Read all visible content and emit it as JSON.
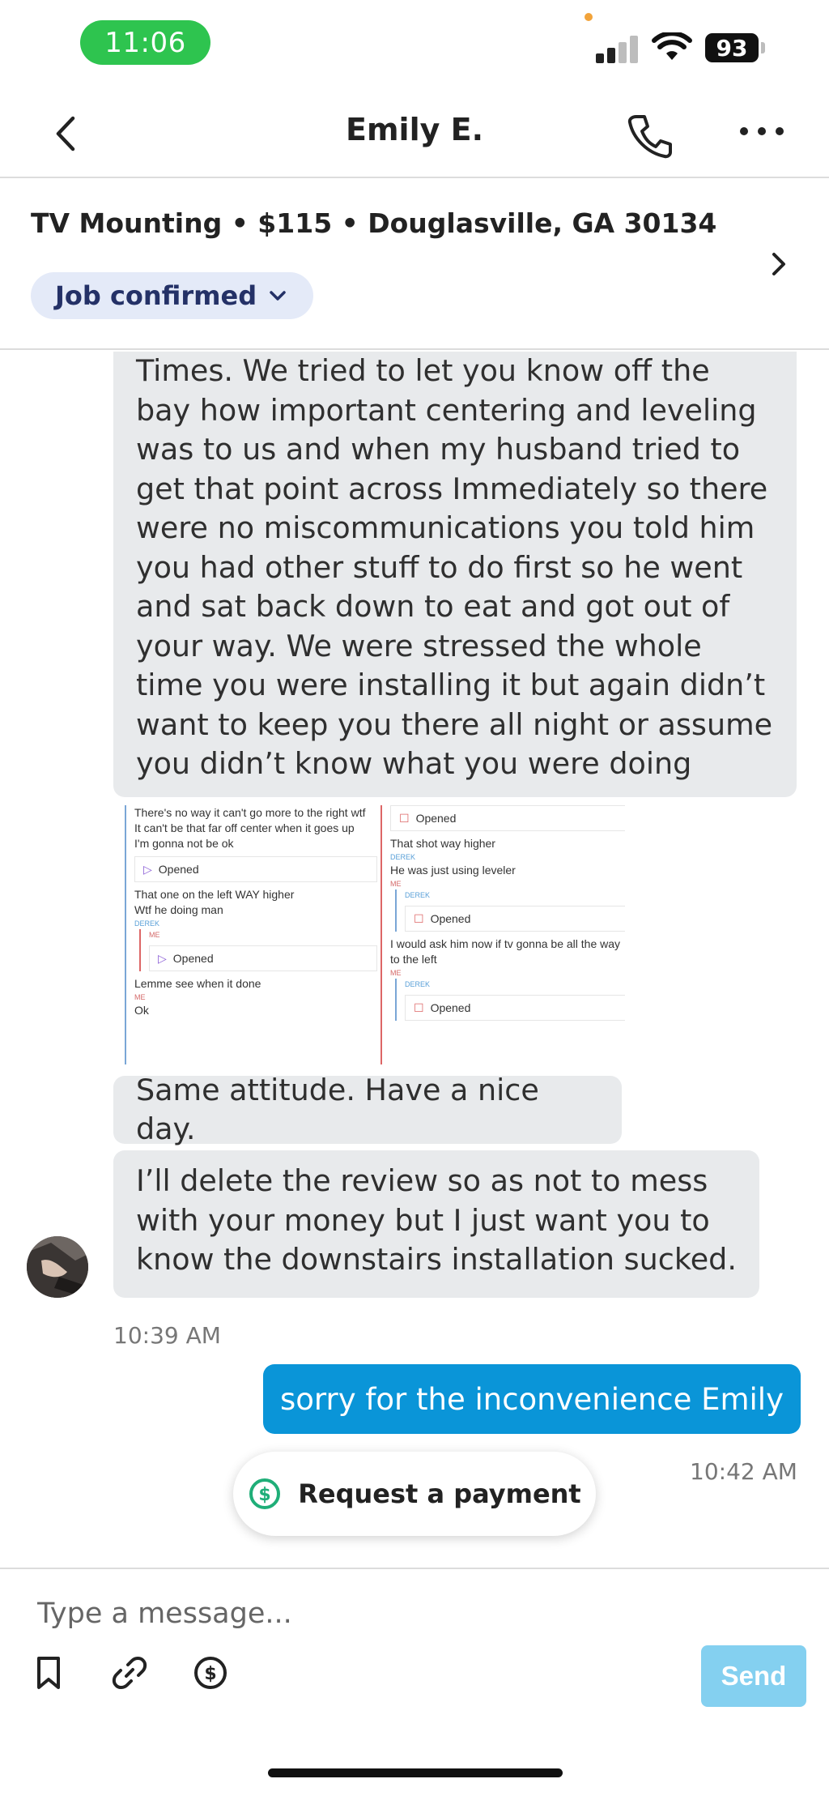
{
  "status_bar": {
    "time": "11:06",
    "battery": "93"
  },
  "header": {
    "contact_name": "Emily E."
  },
  "job": {
    "title": "TV Mounting • $115 • Douglasville, GA 30134",
    "status": "Job confirmed"
  },
  "messages": {
    "incoming_long": "Times. We tried to let you know off the\nbay how important centering and leveling\nwas to us and when my husband tried to\nget that point across Immediately so there\nwere no miscommunications you told him\nyou had other stuff to do first so he went\nand sat back down to eat and got out of\nyour way. We were stressed the whole\ntime you were installing it but again didn’t\nwant to keep you there all night or assume\nyou didn’t know what you were doing",
    "screenshot": {
      "left": {
        "line1": "There's no way it can't go more to the right wtf",
        "line2": "It can't be that far off center when it goes up",
        "line3": "I'm gonna not be ok",
        "opened1": "Opened",
        "line4": "That one on the left WAY higher",
        "line5": "Wtf he doing man",
        "sender1": "DEREK",
        "sender2": "ME",
        "opened2": "Opened",
        "line6": "Lemme see when it done",
        "sender3": "ME",
        "line7": "Ok"
      },
      "right": {
        "opened1": "Opened",
        "line1": "That shot way higher",
        "sender1": "DEREK",
        "line2": "He was just using leveler",
        "sender2": "ME",
        "sender3": "DEREK",
        "opened2": "Opened",
        "line3": "I would ask him now if tv gonna be all the way",
        "line4": "to the left",
        "sender4": "ME",
        "sender5": "DEREK",
        "opened3": "Opened"
      }
    },
    "incoming_short": "Same attitude. Have a nice day.",
    "incoming_last": "I’ll delete the review so as not to mess\nwith your money but I just want you to\nknow the downstairs installation sucked.",
    "incoming_time": "10:39 AM",
    "outgoing": "sorry for the inconvenience Emily",
    "outgoing_time": "10:42 AM"
  },
  "actions": {
    "request_payment": "Request a payment"
  },
  "composer": {
    "placeholder": "Type a message...",
    "send_label": "Send"
  },
  "colors": {
    "outgoing_bubble": "#0a95d8",
    "incoming_bubble": "#e8eaec",
    "time_pill": "#2ec44f",
    "badge_bg": "#e4eaf8",
    "payment_icon": "#1fae78",
    "send_disabled": "#84d0f0"
  },
  "icons": [
    "back-icon",
    "phone-icon",
    "more-icon",
    "chevron-right-icon",
    "chevron-down-icon",
    "dollar-circle-icon",
    "bookmark-icon",
    "link-icon",
    "dollar-icon"
  ]
}
